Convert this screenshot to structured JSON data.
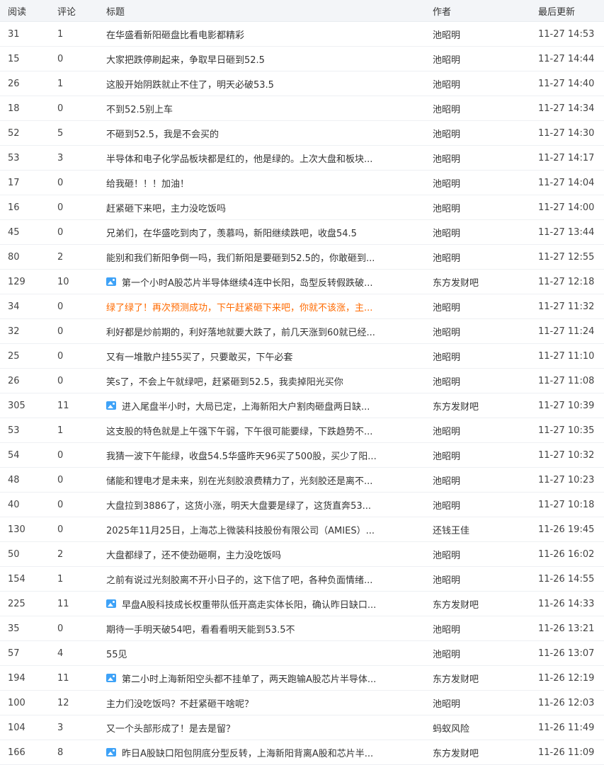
{
  "header": {
    "read": "阅读",
    "comment": "评论",
    "title": "标题",
    "author": "作者",
    "updated": "最后更新"
  },
  "rows": [
    {
      "read": "31",
      "comment": "1",
      "title": "在华盛看新阳砸盘比看电影都精彩",
      "author": "池昭明",
      "time": "11-27 14:53",
      "image": false,
      "highlight": false
    },
    {
      "read": "15",
      "comment": "0",
      "title": "大家把跌停刷起来，争取早日砸到52.5",
      "author": "池昭明",
      "time": "11-27 14:44",
      "image": false,
      "highlight": false
    },
    {
      "read": "26",
      "comment": "1",
      "title": "这股开始阴跌就止不住了，明天必破53.5",
      "author": "池昭明",
      "time": "11-27 14:40",
      "image": false,
      "highlight": false
    },
    {
      "read": "18",
      "comment": "0",
      "title": "不到52.5别上车",
      "author": "池昭明",
      "time": "11-27 14:34",
      "image": false,
      "highlight": false
    },
    {
      "read": "52",
      "comment": "5",
      "title": "不砸到52.5，我是不会买的",
      "author": "池昭明",
      "time": "11-27 14:30",
      "image": false,
      "highlight": false
    },
    {
      "read": "53",
      "comment": "3",
      "title": "半导体和电子化学品板块都是红的，他是绿的。上次大盘和板块...",
      "author": "池昭明",
      "time": "11-27 14:17",
      "image": false,
      "highlight": false
    },
    {
      "read": "17",
      "comment": "0",
      "title": "给我砸！！！加油！",
      "author": "池昭明",
      "time": "11-27 14:04",
      "image": false,
      "highlight": false
    },
    {
      "read": "16",
      "comment": "0",
      "title": "赶紧砸下来吧，主力没吃饭吗",
      "author": "池昭明",
      "time": "11-27 14:00",
      "image": false,
      "highlight": false
    },
    {
      "read": "45",
      "comment": "0",
      "title": "兄弟们，在华盛吃到肉了，羡慕吗，新阳继续跌吧，收盘54.5",
      "author": "池昭明",
      "time": "11-27 13:44",
      "image": false,
      "highlight": false
    },
    {
      "read": "80",
      "comment": "2",
      "title": "能别和我们新阳争倒一吗，我们新阳是要砸到52.5的，你敢砸到...",
      "author": "池昭明",
      "time": "11-27 12:55",
      "image": false,
      "highlight": false
    },
    {
      "read": "129",
      "comment": "10",
      "title": "第一个小时A股芯片半导体继续4连中长阳，岛型反转假跌破...",
      "author": "东方发财吧",
      "time": "11-27 12:18",
      "image": true,
      "highlight": false
    },
    {
      "read": "34",
      "comment": "0",
      "title": "绿了绿了！再次预测成功，下午赶紧砸下来吧，你就不该涨，主...",
      "author": "池昭明",
      "time": "11-27 11:32",
      "image": false,
      "highlight": true
    },
    {
      "read": "32",
      "comment": "0",
      "title": "利好都是炒前期的，利好落地就要大跌了，前几天涨到60就已经...",
      "author": "池昭明",
      "time": "11-27 11:24",
      "image": false,
      "highlight": false
    },
    {
      "read": "25",
      "comment": "0",
      "title": "又有一堆散户挂55买了，只要敢买，下午必套",
      "author": "池昭明",
      "time": "11-27 11:10",
      "image": false,
      "highlight": false
    },
    {
      "read": "26",
      "comment": "0",
      "title": "笑s了，不会上午就绿吧，赶紧砸到52.5，我卖掉阳光买你",
      "author": "池昭明",
      "time": "11-27 11:08",
      "image": false,
      "highlight": false
    },
    {
      "read": "305",
      "comment": "11",
      "title": "进入尾盘半小时，大局已定，上海新阳大户割肉砸盘两日缺...",
      "author": "东方发财吧",
      "time": "11-27 10:39",
      "image": true,
      "highlight": false
    },
    {
      "read": "53",
      "comment": "1",
      "title": "这支股的特色就是上午强下午弱，下午很可能要绿，下跌趋势不...",
      "author": "池昭明",
      "time": "11-27 10:35",
      "image": false,
      "highlight": false
    },
    {
      "read": "54",
      "comment": "0",
      "title": "我猜一波下午能绿，收盘54.5华盛昨天96买了500股，买少了阳...",
      "author": "池昭明",
      "time": "11-27 10:32",
      "image": false,
      "highlight": false
    },
    {
      "read": "48",
      "comment": "0",
      "title": "储能和锂电才是未来，别在光刻胶浪费精力了，光刻胶还是离不...",
      "author": "池昭明",
      "time": "11-27 10:23",
      "image": false,
      "highlight": false
    },
    {
      "read": "40",
      "comment": "0",
      "title": "大盘拉到3886了，这货小涨，明天大盘要是绿了，这货直奔53...",
      "author": "池昭明",
      "time": "11-27 10:18",
      "image": false,
      "highlight": false
    },
    {
      "read": "130",
      "comment": "0",
      "title": "2025年11月25日，上海芯上微装科技股份有限公司（AMIES）...",
      "author": "还钱王佳",
      "time": "11-26 19:45",
      "image": false,
      "highlight": false
    },
    {
      "read": "50",
      "comment": "2",
      "title": "大盘都绿了，还不使劲砸啊，主力没吃饭吗",
      "author": "池昭明",
      "time": "11-26 16:02",
      "image": false,
      "highlight": false
    },
    {
      "read": "154",
      "comment": "1",
      "title": "之前有说过光刻胶离不开小日子的，这下信了吧，各种负面情绪...",
      "author": "池昭明",
      "time": "11-26 14:55",
      "image": false,
      "highlight": false
    },
    {
      "read": "225",
      "comment": "11",
      "title": "早盘A股科技成长权重带队低开高走实体长阳，确认昨日缺口...",
      "author": "东方发财吧",
      "time": "11-26 14:33",
      "image": true,
      "highlight": false
    },
    {
      "read": "35",
      "comment": "0",
      "title": "期待一手明天破54吧，看看看明天能到53.5不",
      "author": "池昭明",
      "time": "11-26 13:21",
      "image": false,
      "highlight": false
    },
    {
      "read": "57",
      "comment": "4",
      "title": "55见",
      "author": "池昭明",
      "time": "11-26 13:07",
      "image": false,
      "highlight": false
    },
    {
      "read": "194",
      "comment": "11",
      "title": "第二小时上海新阳空头都不挂单了，两天跑输A股芯片半导体...",
      "author": "东方发财吧",
      "time": "11-26 12:19",
      "image": true,
      "highlight": false
    },
    {
      "read": "100",
      "comment": "12",
      "title": "主力们没吃饭吗？不赶紧砸干啥呢？",
      "author": "池昭明",
      "time": "11-26 12:03",
      "image": false,
      "highlight": false
    },
    {
      "read": "104",
      "comment": "3",
      "title": "又一个头部形成了！是去是留？",
      "author": "蚂蚁风险",
      "time": "11-26 11:49",
      "image": false,
      "highlight": false
    },
    {
      "read": "166",
      "comment": "8",
      "title": "昨日A股缺口阳包阴底分型反转，上海新阳背离A股和芯片半...",
      "author": "东方发财吧",
      "time": "11-26 11:09",
      "image": true,
      "highlight": false
    }
  ]
}
